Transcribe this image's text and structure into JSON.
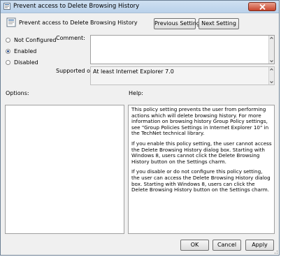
{
  "window": {
    "title": "Prevent access to Delete Browsing History"
  },
  "header": {
    "title": "Prevent access to Delete Browsing History"
  },
  "nav": {
    "previous_label": "Previous Setting",
    "next_label": "Next Setting"
  },
  "state": {
    "options": [
      {
        "label": "Not Configured",
        "selected": false
      },
      {
        "label": "Enabled",
        "selected": true
      },
      {
        "label": "Disabled",
        "selected": false
      }
    ]
  },
  "comment": {
    "label": "Comment:",
    "value": ""
  },
  "supported": {
    "label": "Supported on:",
    "value": "At least Internet Explorer 7.0"
  },
  "options_panel": {
    "label": "Options:"
  },
  "help_panel": {
    "label": "Help:",
    "paragraphs": [
      "This policy setting prevents the user from performing actions which will delete browsing history. For more information on browsing history Group Policy settings, see \"Group Policies Settings in Internet Explorer 10\" in the TechNet technical library.",
      "If you enable this policy setting, the user cannot access the Delete Browsing History dialog box. Starting with Windows 8, users cannot click the Delete Browsing History button on the Settings charm.",
      "If you disable or do not configure this policy setting, the user can access the Delete Browsing History dialog box. Starting with Windows 8, users can click the Delete Browsing History button on the Settings charm."
    ]
  },
  "footer": {
    "ok_label": "OK",
    "cancel_label": "Cancel",
    "apply_label": "Apply"
  }
}
